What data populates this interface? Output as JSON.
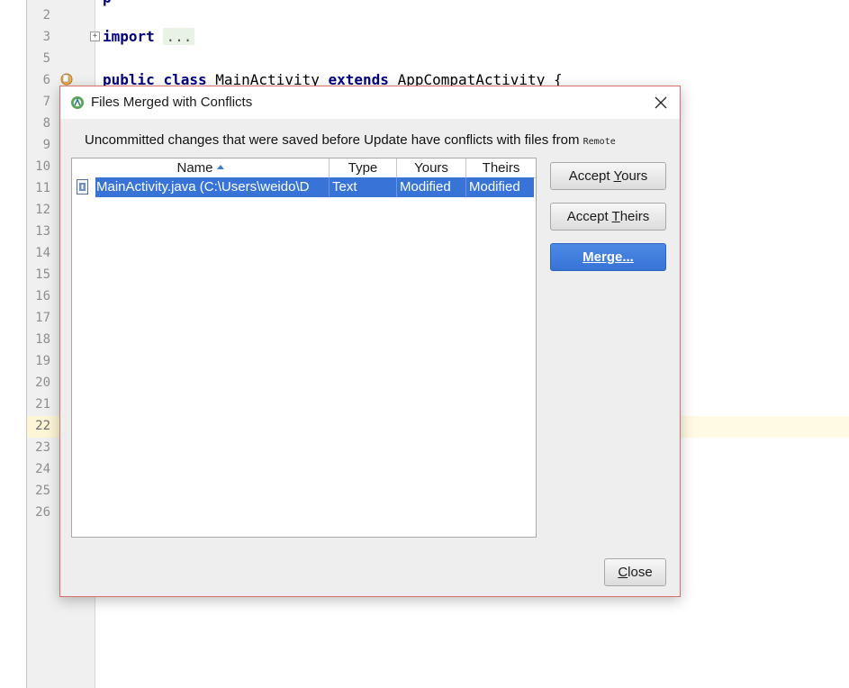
{
  "editor": {
    "line_numbers": [
      "2",
      "3",
      "5",
      "6",
      "7",
      "8",
      "9",
      "10",
      "11",
      "12",
      "13",
      "14",
      "15",
      "16",
      "17",
      "18",
      "19",
      "20",
      "21",
      "22",
      "23",
      "24",
      "25",
      "26"
    ],
    "active_line": "22",
    "code_import_kw": "import",
    "code_import_folded": "...",
    "code_public_kw": "public",
    "code_class_kw": "class",
    "code_class_name": "MainActivity",
    "code_extends_kw": "extends",
    "code_parent": "AppCompatActivity {"
  },
  "dialog": {
    "title": "Files Merged with Conflicts",
    "message": "Uncommitted changes that were saved before Update have conflicts with files from",
    "message_remote": "Remote",
    "table": {
      "columns": [
        "Name",
        "Type",
        "Yours",
        "Theirs"
      ],
      "rows": [
        {
          "name": "MainActivity.java (C:\\Users\\weido\\D",
          "type": "Text",
          "yours": "Modified",
          "theirs": "Modified"
        }
      ]
    },
    "buttons": {
      "accept_yours_pre": "Accept ",
      "accept_yours_mn": "Y",
      "accept_yours_post": "ours",
      "accept_theirs_pre": "Accept ",
      "accept_theirs_mn": "T",
      "accept_theirs_post": "heirs",
      "merge_mn": "M",
      "merge_post": "erge...",
      "close_mn": "C",
      "close_post": "lose"
    }
  },
  "colors": {
    "selection": "#3874d8",
    "primary_button": "#3673d6",
    "dialog_border": "#d7706a",
    "keyword": "#000080"
  }
}
